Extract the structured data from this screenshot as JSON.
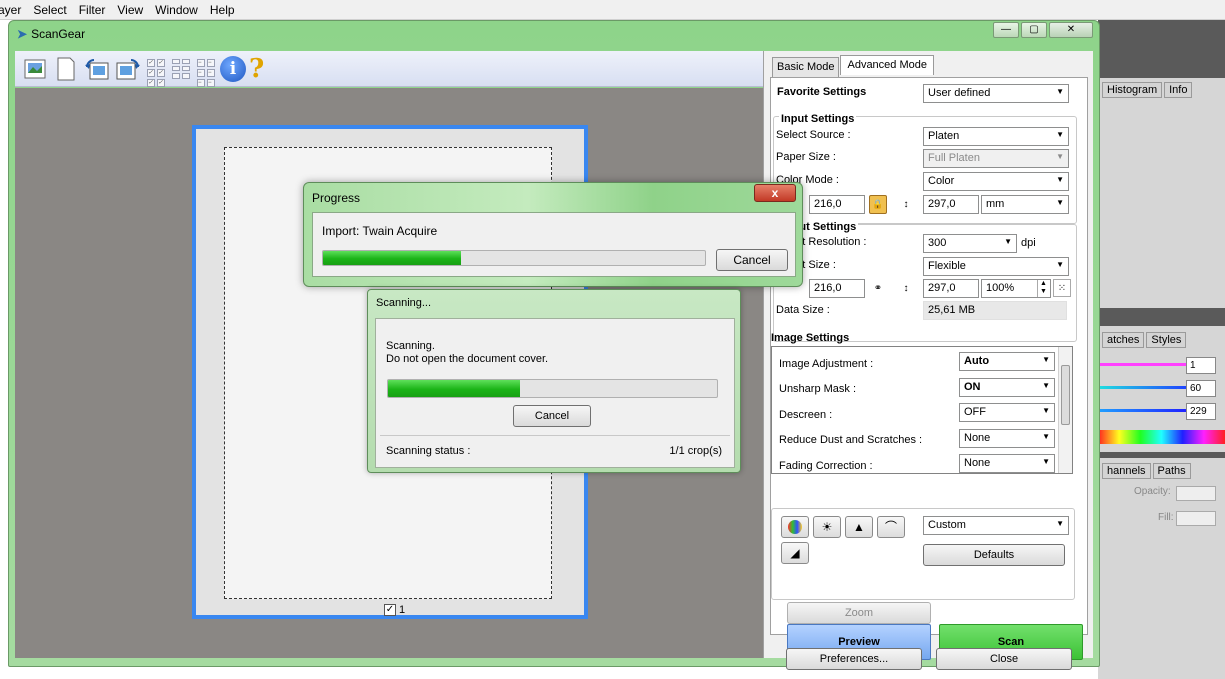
{
  "host_app": {
    "menu": [
      "ayer",
      "Select",
      "Filter",
      "View",
      "Window",
      "Help"
    ],
    "panel_tabs_1": [
      "Histogram",
      "Info"
    ],
    "panel_tabs_2": [
      "atches",
      "Styles"
    ],
    "panel_tabs_3": [
      "hannels",
      "Paths"
    ],
    "color_values": [
      "1",
      "60",
      "229"
    ],
    "opacity_label": "Opacity:",
    "fill_label": "Fill:"
  },
  "window": {
    "title": "ScanGear",
    "controls": [
      "—",
      "▢",
      "✕"
    ]
  },
  "toolbar": {
    "icons": [
      "scan-photo-icon",
      "blank-page-icon",
      "rotate-left-icon",
      "rotate-right-icon"
    ],
    "info_glyph": "i",
    "help_glyph": "?"
  },
  "preview": {
    "crop_checked": true,
    "crop_number": "1"
  },
  "settings": {
    "tabs": [
      "Basic Mode",
      "Advanced Mode"
    ],
    "active_tab": 1,
    "favorite_label": "Favorite Settings",
    "favorite_value": "User defined",
    "input_header": "Input Settings",
    "select_source_label": "Select Source :",
    "select_source_value": "Platen",
    "paper_size_label": "Paper Size :",
    "paper_size_value": "Full Platen",
    "color_mode_label": "Color Mode :",
    "color_mode_value": "Color",
    "input_width": "216,0",
    "input_height": "297,0",
    "unit_value": "mm",
    "output_header": "tput Settings",
    "output_res_label": "tput Resolution :",
    "output_res_value": "300",
    "dpi_label": "dpi",
    "output_size_label": "tput Size :",
    "output_size_value": "Flexible",
    "output_width": "216,0",
    "output_height": "297,0",
    "scale_value": "100%",
    "data_size_label": "Data Size :",
    "data_size_value": "25,61 MB",
    "image_header": "Image Settings",
    "image_rows": [
      {
        "label": "Image Adjustment :",
        "value": "Auto",
        "bold": true
      },
      {
        "label": "Unsharp Mask :",
        "value": "ON",
        "bold": true
      },
      {
        "label": "Descreen :",
        "value": "OFF",
        "bold": false
      },
      {
        "label": "Reduce Dust and Scratches :",
        "value": "None",
        "bold": false
      },
      {
        "label": "Fading Correction :",
        "value": "None",
        "bold": false
      }
    ],
    "custom_value": "Custom",
    "defaults_label": "Defaults",
    "zoom_label": "Zoom",
    "preview_label": "Preview",
    "scan_label": "Scan",
    "preferences_label": "Preferences...",
    "close_label": "Close"
  },
  "progress_dialog": {
    "title": "Progress",
    "message": "Import: Twain Acquire",
    "progress": 0.36,
    "cancel_label": "Cancel",
    "close_glyph": "x"
  },
  "scanning_dialog": {
    "title": "Scanning...",
    "line1": "Scanning.",
    "line2": "Do not open the document cover.",
    "progress": 0.4,
    "cancel_label": "Cancel",
    "status_label": "Scanning status :",
    "status_value": "1/1 crop(s)"
  }
}
